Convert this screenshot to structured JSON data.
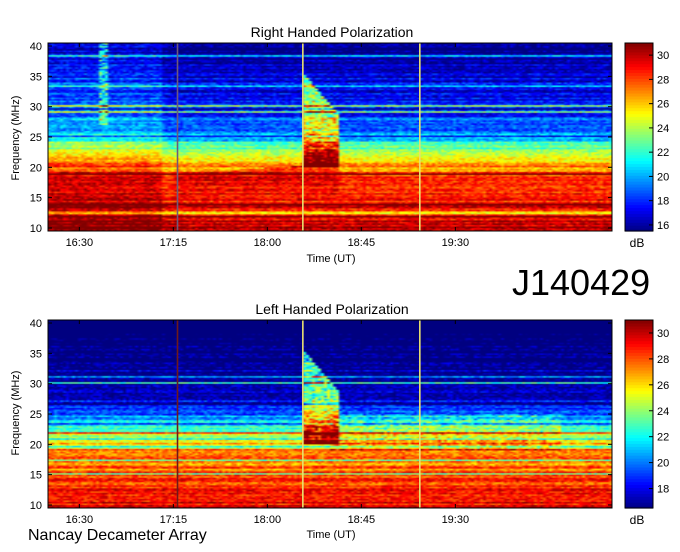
{
  "figure_label": "J140429",
  "footer_label": "Nancay Decameter Array",
  "chart_data": [
    {
      "type": "heatmap",
      "title": "Right Handed Polarization",
      "xlabel": "Time (UT)",
      "ylabel": "Frequency (MHz)",
      "x_ticks": [
        "16:30",
        "17:15",
        "18:00",
        "18:45",
        "19:30"
      ],
      "x_tick_minutes": [
        990,
        1035,
        1080,
        1125,
        1170
      ],
      "xlim_minutes": [
        975,
        1245
      ],
      "y_ticks": [
        10,
        15,
        20,
        25,
        30,
        35,
        40
      ],
      "ylim": [
        9.5,
        40.5
      ],
      "colorbar": {
        "label": "dB",
        "ticks": [
          16,
          18,
          20,
          22,
          24,
          26,
          28,
          30
        ],
        "range": [
          15.5,
          31
        ]
      },
      "vertical_lines": [
        {
          "minute": 1037,
          "color": "#6e5a7a"
        },
        {
          "minute": 1097,
          "color": "#e8e070"
        },
        {
          "minute": 1153,
          "color": "#e8e070"
        }
      ],
      "burst_minute": 1101,
      "grid": false
    },
    {
      "type": "heatmap",
      "title": "Left Handed Polarization",
      "xlabel": "Time (UT)",
      "ylabel": "Frequency (MHz)",
      "x_ticks": [
        "16:30",
        "17:15",
        "18:00",
        "18:45",
        "19:30"
      ],
      "x_tick_minutes": [
        990,
        1035,
        1080,
        1125,
        1170
      ],
      "xlim_minutes": [
        975,
        1245
      ],
      "y_ticks": [
        10,
        15,
        20,
        25,
        30,
        35,
        40
      ],
      "ylim": [
        9.5,
        40.5
      ],
      "colorbar": {
        "label": "dB",
        "ticks": [
          18,
          20,
          22,
          24,
          26,
          28,
          30
        ],
        "range": [
          16.5,
          31
        ]
      },
      "vertical_lines": [
        {
          "minute": 1037,
          "color": "#6e1a1a"
        },
        {
          "minute": 1097,
          "color": "#e8e070"
        },
        {
          "minute": 1153,
          "color": "#e8e070"
        }
      ],
      "burst_minute": 1101,
      "grid": false
    }
  ]
}
